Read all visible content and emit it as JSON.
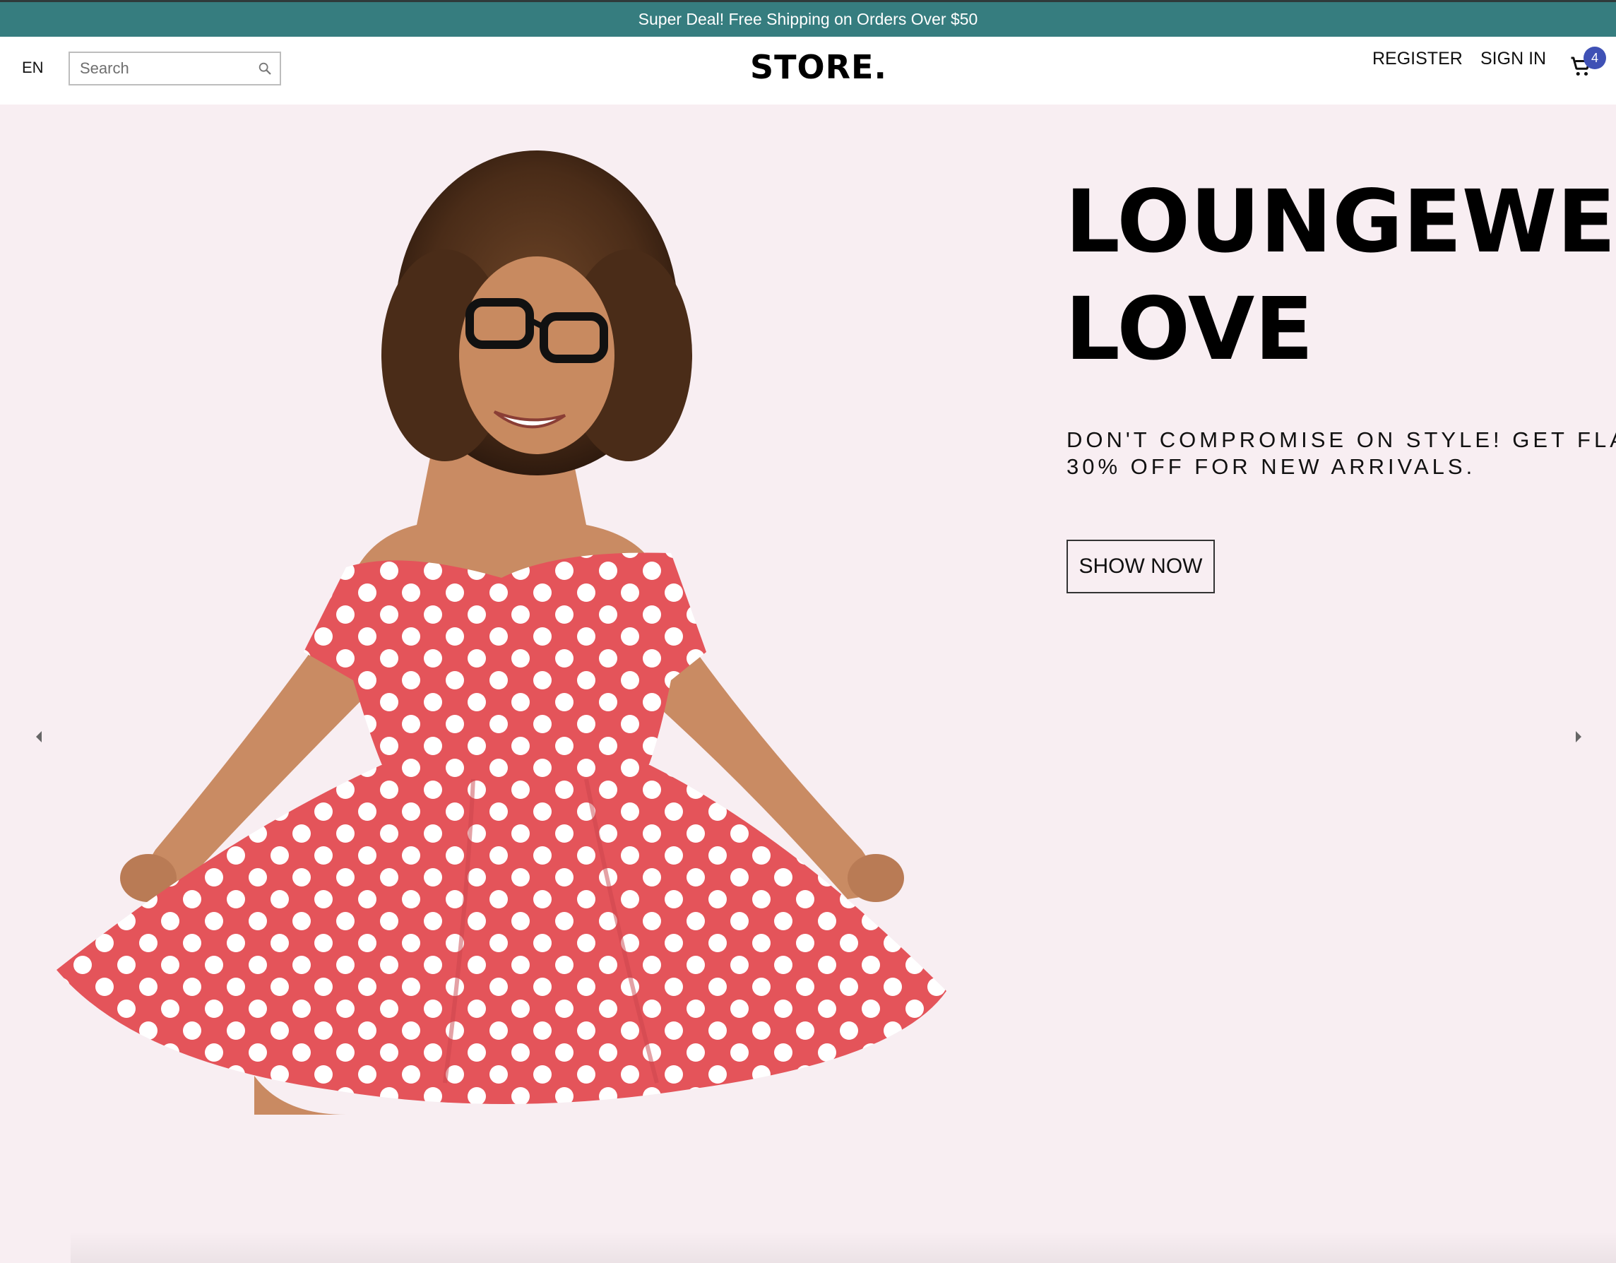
{
  "announcement": {
    "text": "Super Deal! Free Shipping on Orders Over $50",
    "background": "#367d7f"
  },
  "navbar": {
    "language": "EN",
    "search": {
      "placeholder": "Search",
      "value": ""
    },
    "logo": "STORE.",
    "links": {
      "register": "REGISTER",
      "sign_in": "SIGN IN"
    },
    "cart": {
      "icon": "shopping-cart-icon",
      "count": "4",
      "badge_color": "#3f51b5"
    }
  },
  "hero": {
    "background": "#f8eef2",
    "image": "woman-in-red-polka-dot-dress",
    "title_lines": [
      "LOUNGEWEAR",
      "LOVE"
    ],
    "description_lines": [
      "DON'T COMPROMISE ON STYLE! GET FLAT",
      "30% OFF FOR NEW ARRIVALS."
    ],
    "button_label": "SHOW NOW",
    "arrows": {
      "left": "arrow-left-icon",
      "right": "arrow-right-icon"
    }
  }
}
